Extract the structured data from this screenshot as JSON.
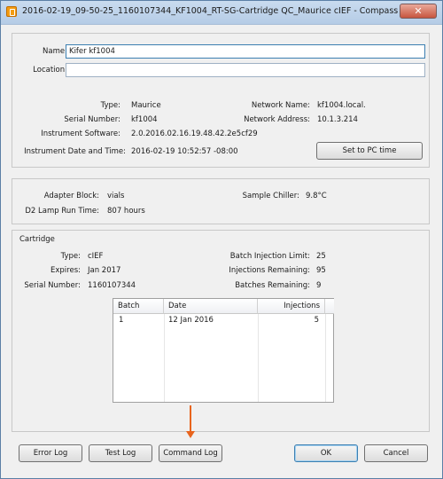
{
  "window": {
    "title": "2016-02-19_09-50-25_1160107344_KF1004_RT-SG-Cartridge QC_Maurice cIEF - Compass for iCE",
    "close_glyph": "✕"
  },
  "identity": {
    "name_label": "Name:",
    "name_value": "Kifer kf1004",
    "location_label": "Location:",
    "location_value": ""
  },
  "instrument": {
    "type_label": "Type:",
    "type_value": "Maurice",
    "serial_label": "Serial Number:",
    "serial_value": "kf1004",
    "software_label": "Instrument Software:",
    "software_value": "2.0.2016.02.16.19.48.42.2e5cf29",
    "datetime_label": "Instrument Date and Time:",
    "datetime_value": "2016-02-19 10:52:57 -08:00",
    "network_name_label": "Network Name:",
    "network_name_value": "kf1004.local.",
    "network_address_label": "Network Address:",
    "network_address_value": "10.1.3.214",
    "set_pc_time_label": "Set to PC time"
  },
  "hardware": {
    "adapter_label": "Adapter Block:",
    "adapter_value": "vials",
    "lamp_label": "D2 Lamp Run Time:",
    "lamp_value": "807 hours",
    "chiller_label": "Sample Chiller:",
    "chiller_value": "9.8°C"
  },
  "cartridge": {
    "section_title": "Cartridge",
    "type_label": "Type:",
    "type_value": "cIEF",
    "expires_label": "Expires:",
    "expires_value": "Jan 2017",
    "serial_label": "Serial Number:",
    "serial_value": "1160107344",
    "batch_limit_label": "Batch Injection Limit:",
    "batch_limit_value": "25",
    "inj_remaining_label": "Injections Remaining:",
    "inj_remaining_value": "95",
    "batches_remaining_label": "Batches Remaining:",
    "batches_remaining_value": "9",
    "table": {
      "columns": [
        "Batch",
        "Date",
        "Injections"
      ],
      "rows": [
        {
          "batch": "1",
          "date": "12 Jan 2016",
          "injections": "5"
        }
      ]
    }
  },
  "footer": {
    "error_log": "Error Log",
    "test_log": "Test Log",
    "command_log": "Command Log",
    "ok": "OK",
    "cancel": "Cancel"
  },
  "colors": {
    "annotation_arrow": "#e8641d",
    "title_bar": "#c9dbef",
    "close_button": "#c7553f"
  }
}
